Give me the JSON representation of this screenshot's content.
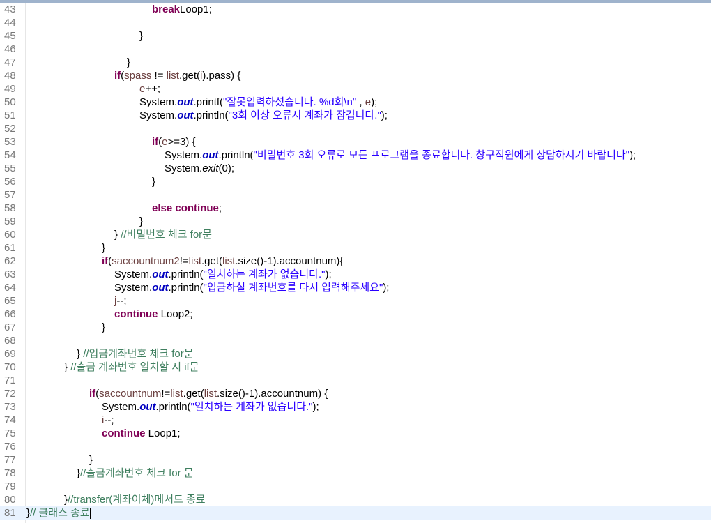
{
  "lines": [
    {
      "n": "43",
      "indent": 218,
      "segs": [
        [
          "kw",
          "break"
        ],
        [
          "",
          "Loop1;"
        ]
      ]
    },
    {
      "n": "44",
      "indent": 0,
      "segs": []
    },
    {
      "n": "45",
      "indent": 200,
      "segs": [
        [
          "",
          "}"
        ]
      ]
    },
    {
      "n": "46",
      "indent": 0,
      "segs": []
    },
    {
      "n": "47",
      "indent": 182,
      "segs": [
        [
          "",
          "}"
        ]
      ]
    },
    {
      "n": "48",
      "indent": 164,
      "segs": [
        [
          "kw",
          "if"
        ],
        [
          "",
          "("
        ],
        [
          "var",
          "spass"
        ],
        [
          "",
          " != "
        ],
        [
          "var",
          "list"
        ],
        [
          "",
          ".get("
        ],
        [
          "var",
          "i"
        ],
        [
          "",
          ").pass) {"
        ]
      ]
    },
    {
      "n": "49",
      "indent": 200,
      "segs": [
        [
          "var",
          "e"
        ],
        [
          "",
          "++;"
        ]
      ]
    },
    {
      "n": "50",
      "indent": 200,
      "segs": [
        [
          "",
          "System."
        ],
        [
          "fld",
          "out"
        ],
        [
          "",
          ".printf("
        ],
        [
          "str",
          "\"잘못입력하셨습니다. %d회\\n\""
        ],
        [
          "",
          " , "
        ],
        [
          "var",
          "e"
        ],
        [
          "",
          ");"
        ]
      ]
    },
    {
      "n": "51",
      "indent": 200,
      "segs": [
        [
          "",
          "System."
        ],
        [
          "fld",
          "out"
        ],
        [
          "",
          ".println("
        ],
        [
          "str",
          "\"3회 이상 오류시 계좌가 잠깁니다.\""
        ],
        [
          "",
          ");"
        ]
      ]
    },
    {
      "n": "52",
      "indent": 0,
      "segs": []
    },
    {
      "n": "53",
      "indent": 218,
      "segs": [
        [
          "kw",
          "if"
        ],
        [
          "",
          "("
        ],
        [
          "var",
          "e"
        ],
        [
          "",
          ">=3) {"
        ]
      ]
    },
    {
      "n": "54",
      "indent": 236,
      "segs": [
        [
          "",
          "System."
        ],
        [
          "fld",
          "out"
        ],
        [
          "",
          ".println("
        ],
        [
          "str",
          "\"비밀번호 3회 오류로 모든 프로그램을 종료합니다. 창구직원에게 상담하시기 바랍니다\""
        ],
        [
          "",
          ");"
        ]
      ]
    },
    {
      "n": "55",
      "indent": 236,
      "segs": [
        [
          "",
          "System."
        ],
        [
          "ital",
          "exit"
        ],
        [
          "",
          "(0);"
        ]
      ]
    },
    {
      "n": "56",
      "indent": 218,
      "segs": [
        [
          "",
          "}"
        ]
      ]
    },
    {
      "n": "57",
      "indent": 0,
      "segs": []
    },
    {
      "n": "58",
      "indent": 218,
      "segs": [
        [
          "kw",
          "else"
        ],
        [
          "",
          " "
        ],
        [
          "kw",
          "continue"
        ],
        [
          "",
          ";"
        ]
      ]
    },
    {
      "n": "59",
      "indent": 200,
      "segs": [
        [
          "",
          "}"
        ]
      ]
    },
    {
      "n": "60",
      "indent": 164,
      "segs": [
        [
          "",
          "} "
        ],
        [
          "cm",
          "//비밀번호 체크 for문"
        ]
      ]
    },
    {
      "n": "61",
      "indent": 146,
      "segs": [
        [
          "",
          "}"
        ]
      ]
    },
    {
      "n": "62",
      "indent": 146,
      "segs": [
        [
          "kw",
          "if"
        ],
        [
          "",
          "("
        ],
        [
          "var",
          "saccountnum2"
        ],
        [
          "",
          "!="
        ],
        [
          "var",
          "list"
        ],
        [
          "",
          ".get("
        ],
        [
          "var",
          "list"
        ],
        [
          "",
          ".size()-1).accountnum){"
        ]
      ]
    },
    {
      "n": "63",
      "indent": 164,
      "segs": [
        [
          "",
          "System."
        ],
        [
          "fld",
          "out"
        ],
        [
          "",
          ".println("
        ],
        [
          "str",
          "\"일치하는 계좌가 없습니다.\""
        ],
        [
          "",
          ");"
        ]
      ]
    },
    {
      "n": "64",
      "indent": 164,
      "segs": [
        [
          "",
          "System."
        ],
        [
          "fld",
          "out"
        ],
        [
          "",
          ".println("
        ],
        [
          "str",
          "\"입금하실 계좌번호를 다시 입력해주세요\""
        ],
        [
          "",
          ");"
        ]
      ]
    },
    {
      "n": "65",
      "indent": 164,
      "segs": [
        [
          "var",
          "j"
        ],
        [
          "",
          "--;"
        ]
      ]
    },
    {
      "n": "66",
      "indent": 164,
      "segs": [
        [
          "kw",
          "continue"
        ],
        [
          "",
          " Loop2;"
        ]
      ]
    },
    {
      "n": "67",
      "indent": 146,
      "segs": [
        [
          "",
          "}"
        ]
      ]
    },
    {
      "n": "68",
      "indent": 0,
      "segs": []
    },
    {
      "n": "69",
      "indent": 110,
      "segs": [
        [
          "",
          "} "
        ],
        [
          "cm",
          "//입금계좌번호 체크 for문"
        ]
      ]
    },
    {
      "n": "70",
      "indent": 92,
      "segs": [
        [
          "",
          "} "
        ],
        [
          "cm",
          "//출금 계좌번호 일치할 시 if문"
        ]
      ]
    },
    {
      "n": "71",
      "indent": 0,
      "segs": []
    },
    {
      "n": "72",
      "indent": 128,
      "segs": [
        [
          "kw",
          "if"
        ],
        [
          "",
          "("
        ],
        [
          "var",
          "saccountnum"
        ],
        [
          "",
          "!="
        ],
        [
          "var",
          "list"
        ],
        [
          "",
          ".get("
        ],
        [
          "var",
          "list"
        ],
        [
          "",
          ".size()-1).accountnum) {"
        ]
      ]
    },
    {
      "n": "73",
      "indent": 146,
      "segs": [
        [
          "",
          "System."
        ],
        [
          "fld",
          "out"
        ],
        [
          "",
          ".println("
        ],
        [
          "str",
          "\"일치하는 계좌가 없습니다.\""
        ],
        [
          "",
          ");"
        ]
      ]
    },
    {
      "n": "74",
      "indent": 146,
      "segs": [
        [
          "var",
          "i"
        ],
        [
          "",
          "--;"
        ]
      ]
    },
    {
      "n": "75",
      "indent": 146,
      "segs": [
        [
          "kw",
          "continue"
        ],
        [
          "",
          " Loop1;"
        ]
      ]
    },
    {
      "n": "76",
      "indent": 0,
      "segs": []
    },
    {
      "n": "77",
      "indent": 128,
      "segs": [
        [
          "",
          "}"
        ]
      ]
    },
    {
      "n": "78",
      "indent": 110,
      "segs": [
        [
          "",
          "}"
        ],
        [
          "cm",
          "//출금계좌번호 체크 for 문"
        ]
      ]
    },
    {
      "n": "79",
      "indent": 0,
      "segs": []
    },
    {
      "n": "80",
      "indent": 92,
      "segs": [
        [
          "",
          "}"
        ],
        [
          "cm",
          "//transfer(계좌이체)메서드 종료"
        ]
      ]
    },
    {
      "n": "81",
      "indent": 38,
      "segs": [
        [
          "",
          "}"
        ],
        [
          "cm",
          "// 클래스 종료"
        ]
      ],
      "current": true,
      "caret": true
    }
  ]
}
